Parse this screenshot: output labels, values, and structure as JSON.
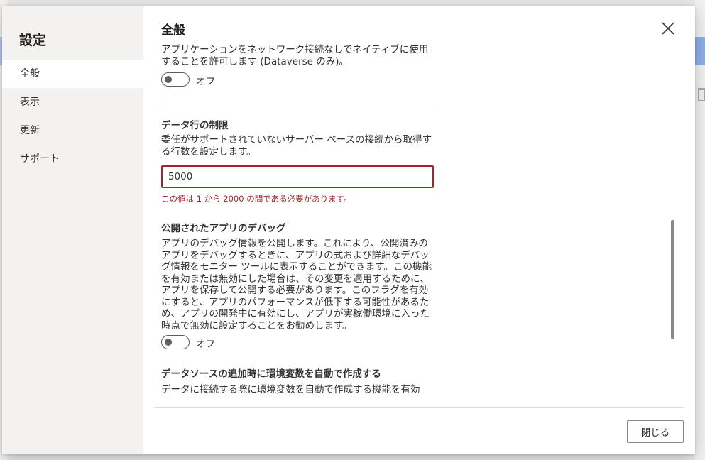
{
  "nav": {
    "title": "設定",
    "items": [
      {
        "label": "全般",
        "active": true
      },
      {
        "label": "表示",
        "active": false
      },
      {
        "label": "更新",
        "active": false
      },
      {
        "label": "サポート",
        "active": false
      }
    ]
  },
  "section": {
    "title": "全般"
  },
  "settings": {
    "offline": {
      "description": "アプリケーションをネットワーク接続なしでネイティブに使用することを許可します (Dataverse のみ)。",
      "toggle_label": "オフ"
    },
    "data_row_limit": {
      "heading": "データ行の制限",
      "description": "委任がサポートされていないサーバー ベースの接続から取得する行数を設定します。",
      "value": "5000",
      "error": "この値は 1 から 2000 の間である必要があります。"
    },
    "debug_published_app": {
      "heading": "公開されたアプリのデバッグ",
      "description": "アプリのデバッグ情報を公開します。これにより、公開済みのアプリをデバッグするときに、アプリの式および詳細なデバッグ情報をモニター ツールに表示することができます。この機能を有効または無効にした場合は、その変更を適用するために、アプリを保存して公開する必要があります。このフラグを有効にすると、アプリのパフォーマンスが低下する可能性があるため、アプリの開発中に有効にし、アプリが実稼働環境に入った時点で無効に設定することをお勧めします。",
      "toggle_label": "オフ"
    },
    "env_variables": {
      "heading": "データソースの追加時に環境変数を自動で作成する",
      "description": "データに接続する際に環境変数を自動で作成する機能を有効"
    }
  },
  "footer": {
    "close_label": "閉じる"
  },
  "icons": {
    "close": "close-icon"
  },
  "colors": {
    "error": "#a4262c",
    "nav_bg": "#f3f2f1"
  }
}
